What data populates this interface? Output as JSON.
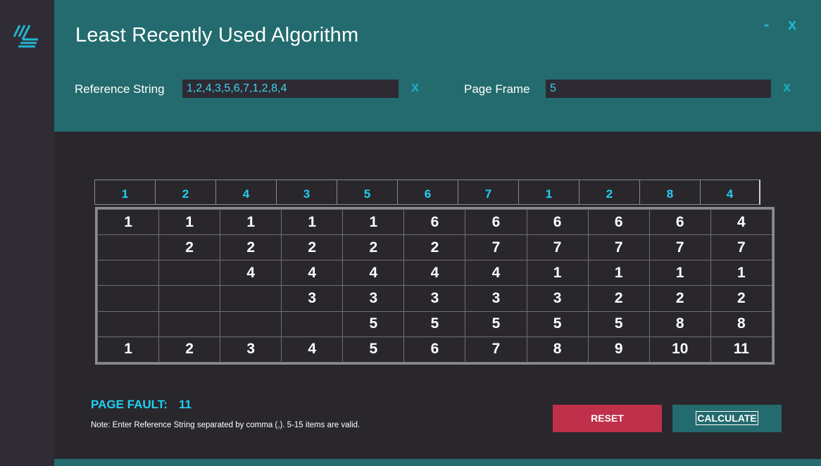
{
  "app": {
    "title": "Least Recently Used Algorithm",
    "minimize_label": "-",
    "close_label": "x"
  },
  "inputs": {
    "reference_label": "Reference String",
    "reference_value": "1,2,4,3,5,6,7,1,2,8,4",
    "frame_label": "Page Frame",
    "frame_value": "5",
    "clear_label": "x"
  },
  "reference": [
    "1",
    "2",
    "4",
    "3",
    "5",
    "6",
    "7",
    "1",
    "2",
    "8",
    "4"
  ],
  "frames": [
    [
      "1",
      "1",
      "1",
      "1",
      "1",
      "6",
      "6",
      "6",
      "6",
      "6",
      "4"
    ],
    [
      "",
      "2",
      "2",
      "2",
      "2",
      "2",
      "7",
      "7",
      "7",
      "7",
      "7"
    ],
    [
      "",
      "",
      "4",
      "4",
      "4",
      "4",
      "4",
      "1",
      "1",
      "1",
      "1"
    ],
    [
      "",
      "",
      "",
      "3",
      "3",
      "3",
      "3",
      "3",
      "2",
      "2",
      "2"
    ],
    [
      "",
      "",
      "",
      "",
      "5",
      "5",
      "5",
      "5",
      "5",
      "8",
      "8"
    ],
    [
      "1",
      "2",
      "3",
      "4",
      "5",
      "6",
      "7",
      "8",
      "9",
      "10",
      "11"
    ]
  ],
  "result": {
    "label": "PAGE FAULT:",
    "value": "11"
  },
  "note": "Note: Enter Reference String separated by  comma (,). 5-15 items are valid.",
  "buttons": {
    "reset": "RESET",
    "calculate": "CALCULATE"
  },
  "colors": {
    "accent": "#236b6e",
    "highlight": "#1fd0f2",
    "danger": "#c0304a"
  }
}
